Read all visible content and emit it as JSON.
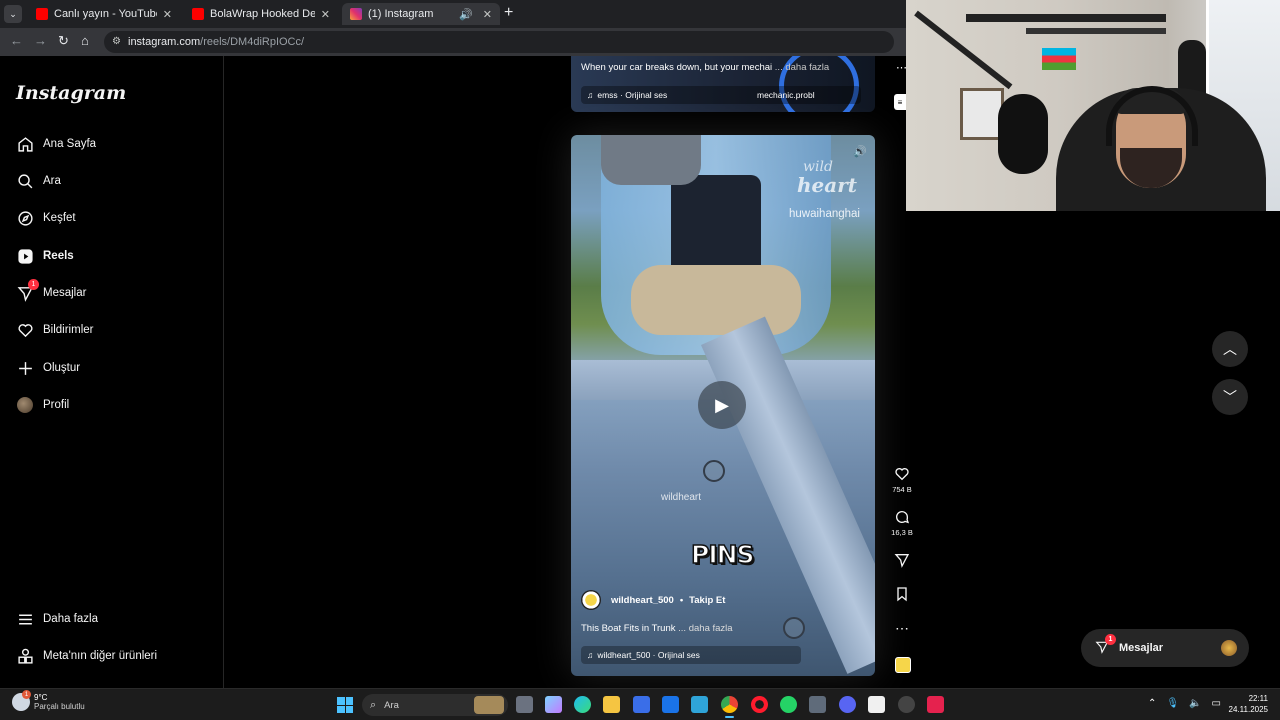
{
  "browser": {
    "tabs": [
      {
        "title": "Canlı yayın - YouTube Studio",
        "favicon": "youtube-icon",
        "active": false
      },
      {
        "title": "BolaWrap Hooked Deep Into M",
        "favicon": "youtube-icon",
        "active": false
      },
      {
        "title": "(1) Instagram",
        "favicon": "instagram-icon",
        "active": true
      }
    ],
    "url_host": "instagram.com",
    "url_path": "/reels/DM4diRpIOCc/"
  },
  "instagram": {
    "logo": "Instagram",
    "nav": [
      {
        "label": "Ana Sayfa",
        "icon": "home-icon"
      },
      {
        "label": "Ara",
        "icon": "search-icon"
      },
      {
        "label": "Keşfet",
        "icon": "compass-icon"
      },
      {
        "label": "Reels",
        "icon": "reels-icon"
      },
      {
        "label": "Mesajlar",
        "icon": "messenger-icon",
        "badge": "1"
      },
      {
        "label": "Bildirimler",
        "icon": "heart-icon"
      },
      {
        "label": "Oluştur",
        "icon": "plus-icon"
      },
      {
        "label": "Profil",
        "icon": "avatar-icon"
      }
    ],
    "nav_bottom": [
      {
        "label": "Daha fazla",
        "icon": "menu-icon"
      },
      {
        "label": "Meta'nın diğer ürünleri",
        "icon": "apps-icon"
      }
    ],
    "prev_reel": {
      "caption": "When your car breaks down, but your mechai",
      "more": "... daha fazla",
      "audio": "emss · Orijinal ses",
      "tag": "mechanic.probl"
    },
    "reel": {
      "watermark1": "wild",
      "watermark2": "heart",
      "watermark3": "huwaihanghai",
      "watermark4": "wildheart",
      "overlay_text": "PINS",
      "author": "wildheart_500",
      "follow": "Takip Et",
      "description": "This Boat Fits in Trunk",
      "more": "... daha fazla",
      "audio": "wildheart_500 · Orijinal ses"
    },
    "actions": {
      "likes": "754 B",
      "comments": "16,3 B"
    },
    "messages_pill": {
      "label": "Mesajlar",
      "badge": "1"
    }
  },
  "taskbar": {
    "weather_temp": "9°C",
    "weather_desc": "Parçalı bulutlu",
    "weather_badge": "1",
    "search_placeholder": "Ara",
    "time": "22:11",
    "date": "24.11.2025"
  }
}
